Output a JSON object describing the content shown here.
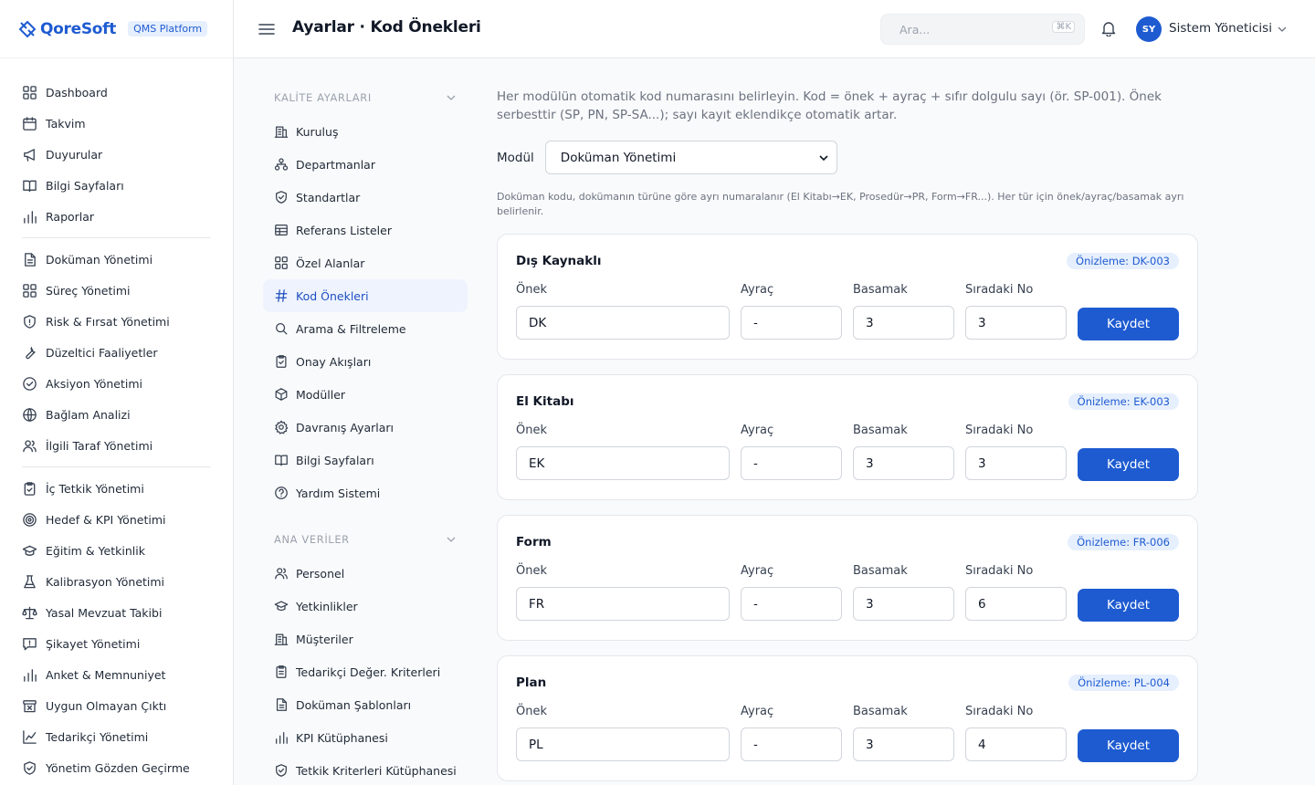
{
  "brand": {
    "name": "QoreSoft",
    "badge": "QMS Platform"
  },
  "header": {
    "title": "Ayarlar · Kod Önekleri",
    "search_placeholder": "Ara...",
    "search_shortcut": "⌘K",
    "user_initials": "SY",
    "user_name": "Sistem Yöneticisi"
  },
  "sidebar": {
    "groups": [
      [
        {
          "label": "Dashboard",
          "icon": "grid-icon"
        },
        {
          "label": "Takvim",
          "icon": "calendar-icon"
        },
        {
          "label": "Duyurular",
          "icon": "megaphone-icon"
        },
        {
          "label": "Bilgi Sayfaları",
          "icon": "book-icon"
        },
        {
          "label": "Raporlar",
          "icon": "bar-chart-icon"
        }
      ],
      [
        {
          "label": "Doküman Yönetimi",
          "icon": "document-icon"
        },
        {
          "label": "Süreç Yönetimi",
          "icon": "grid-icon"
        },
        {
          "label": "Risk & Fırsat Yönetimi",
          "icon": "shield-icon"
        },
        {
          "label": "Düzeltici Faaliyetler",
          "icon": "wrench-icon"
        },
        {
          "label": "Aksiyon Yönetimi",
          "icon": "check-circle-icon"
        },
        {
          "label": "Bağlam Analizi",
          "icon": "globe-icon"
        },
        {
          "label": "İlgili Taraf Yönetimi",
          "icon": "users-icon"
        }
      ],
      [
        {
          "label": "İç Tetkik Yönetimi",
          "icon": "clipboard-check-icon"
        },
        {
          "label": "Hedef & KPI Yönetimi",
          "icon": "target-icon"
        },
        {
          "label": "Eğitim & Yetkinlik",
          "icon": "graduation-cap-icon"
        },
        {
          "label": "Kalibrasyon Yönetimi",
          "icon": "flask-icon"
        },
        {
          "label": "Yasal Mevzuat Takibi",
          "icon": "scale-icon"
        },
        {
          "label": "Şikayet Yönetimi",
          "icon": "message-alert-icon"
        },
        {
          "label": "Anket & Memnuniyet",
          "icon": "bar-chart-icon"
        },
        {
          "label": "Uygun Olmayan Çıktı",
          "icon": "archive-x-icon"
        },
        {
          "label": "Tedarikçi Yönetimi",
          "icon": "line-chart-icon"
        },
        {
          "label": "Yönetim Gözden Geçirme",
          "icon": "shield-check-icon"
        }
      ]
    ]
  },
  "subnav": {
    "sections": [
      {
        "title": "KALİTE AYARLARI",
        "items": [
          {
            "label": "Kuruluş",
            "icon": "building-icon",
            "active": false
          },
          {
            "label": "Departmanlar",
            "icon": "org-chart-icon",
            "active": false
          },
          {
            "label": "Standartlar",
            "icon": "shield-check-icon",
            "active": false
          },
          {
            "label": "Referans Listeler",
            "icon": "table-icon",
            "active": false
          },
          {
            "label": "Özel Alanlar",
            "icon": "grid-icon",
            "active": false
          },
          {
            "label": "Kod Önekleri",
            "icon": "hash-icon",
            "active": true
          },
          {
            "label": "Arama & Filtreleme",
            "icon": "search-icon",
            "active": false
          },
          {
            "label": "Onay Akışları",
            "icon": "clipboard-check-icon",
            "active": false
          },
          {
            "label": "Modüller",
            "icon": "package-icon",
            "active": false
          },
          {
            "label": "Davranış Ayarları",
            "icon": "gear-icon",
            "active": false
          },
          {
            "label": "Bilgi Sayfaları",
            "icon": "book-icon",
            "active": false
          },
          {
            "label": "Yardım Sistemi",
            "icon": "help-circle-icon",
            "active": false
          }
        ]
      },
      {
        "title": "ANA VERİLER",
        "items": [
          {
            "label": "Personel",
            "icon": "users-icon",
            "active": false
          },
          {
            "label": "Yetkinlikler",
            "icon": "graduation-cap-icon",
            "active": false
          },
          {
            "label": "Müşteriler",
            "icon": "building-icon",
            "active": false
          },
          {
            "label": "Tedarikçi Değer. Kriterleri",
            "icon": "clipboard-list-icon",
            "active": false
          },
          {
            "label": "Doküman Şablonları",
            "icon": "document-icon",
            "active": false
          },
          {
            "label": "KPI Kütüphanesi",
            "icon": "bar-chart-icon",
            "active": false
          },
          {
            "label": "Tetkik Kriterleri Kütüphanesi",
            "icon": "shield-check-icon",
            "active": false
          }
        ]
      }
    ]
  },
  "main": {
    "intro": "Her modülün otomatik kod numarasını belirleyin. Kod = önek + ayraç + sıfır dolgulu sayı (ör. SP-001). Önek serbesttir (SP, PN, SP-SA...); sayı kayıt eklendikçe otomatik artar.",
    "module_label": "Modül",
    "module_value": "Doküman Yönetimi",
    "note": "Doküman kodu, dokümanın türüne göre ayrı numaralanır (El Kitabı→EK, Prosedür→PR, Form→FR...). Her tür için önek/ayraç/basamak ayrı belirlenir.",
    "field_labels": {
      "prefix": "Önek",
      "separator": "Ayraç",
      "digits": "Basamak",
      "next": "Sıradaki No"
    },
    "save_label": "Kaydet",
    "cards": [
      {
        "title": "Dış Kaynaklı",
        "preview": "Önizleme: DK-003",
        "prefix": "DK",
        "separator": "-",
        "digits": "3",
        "next": "3"
      },
      {
        "title": "El Kitabı",
        "preview": "Önizleme: EK-003",
        "prefix": "EK",
        "separator": "-",
        "digits": "3",
        "next": "3"
      },
      {
        "title": "Form",
        "preview": "Önizleme: FR-006",
        "prefix": "FR",
        "separator": "-",
        "digits": "3",
        "next": "6"
      },
      {
        "title": "Plan",
        "preview": "Önizleme: PL-004",
        "prefix": "PL",
        "separator": "-",
        "digits": "3",
        "next": "4"
      }
    ]
  },
  "colors": {
    "accent": "#1e5bd1",
    "active_bg": "#eef3fe"
  }
}
